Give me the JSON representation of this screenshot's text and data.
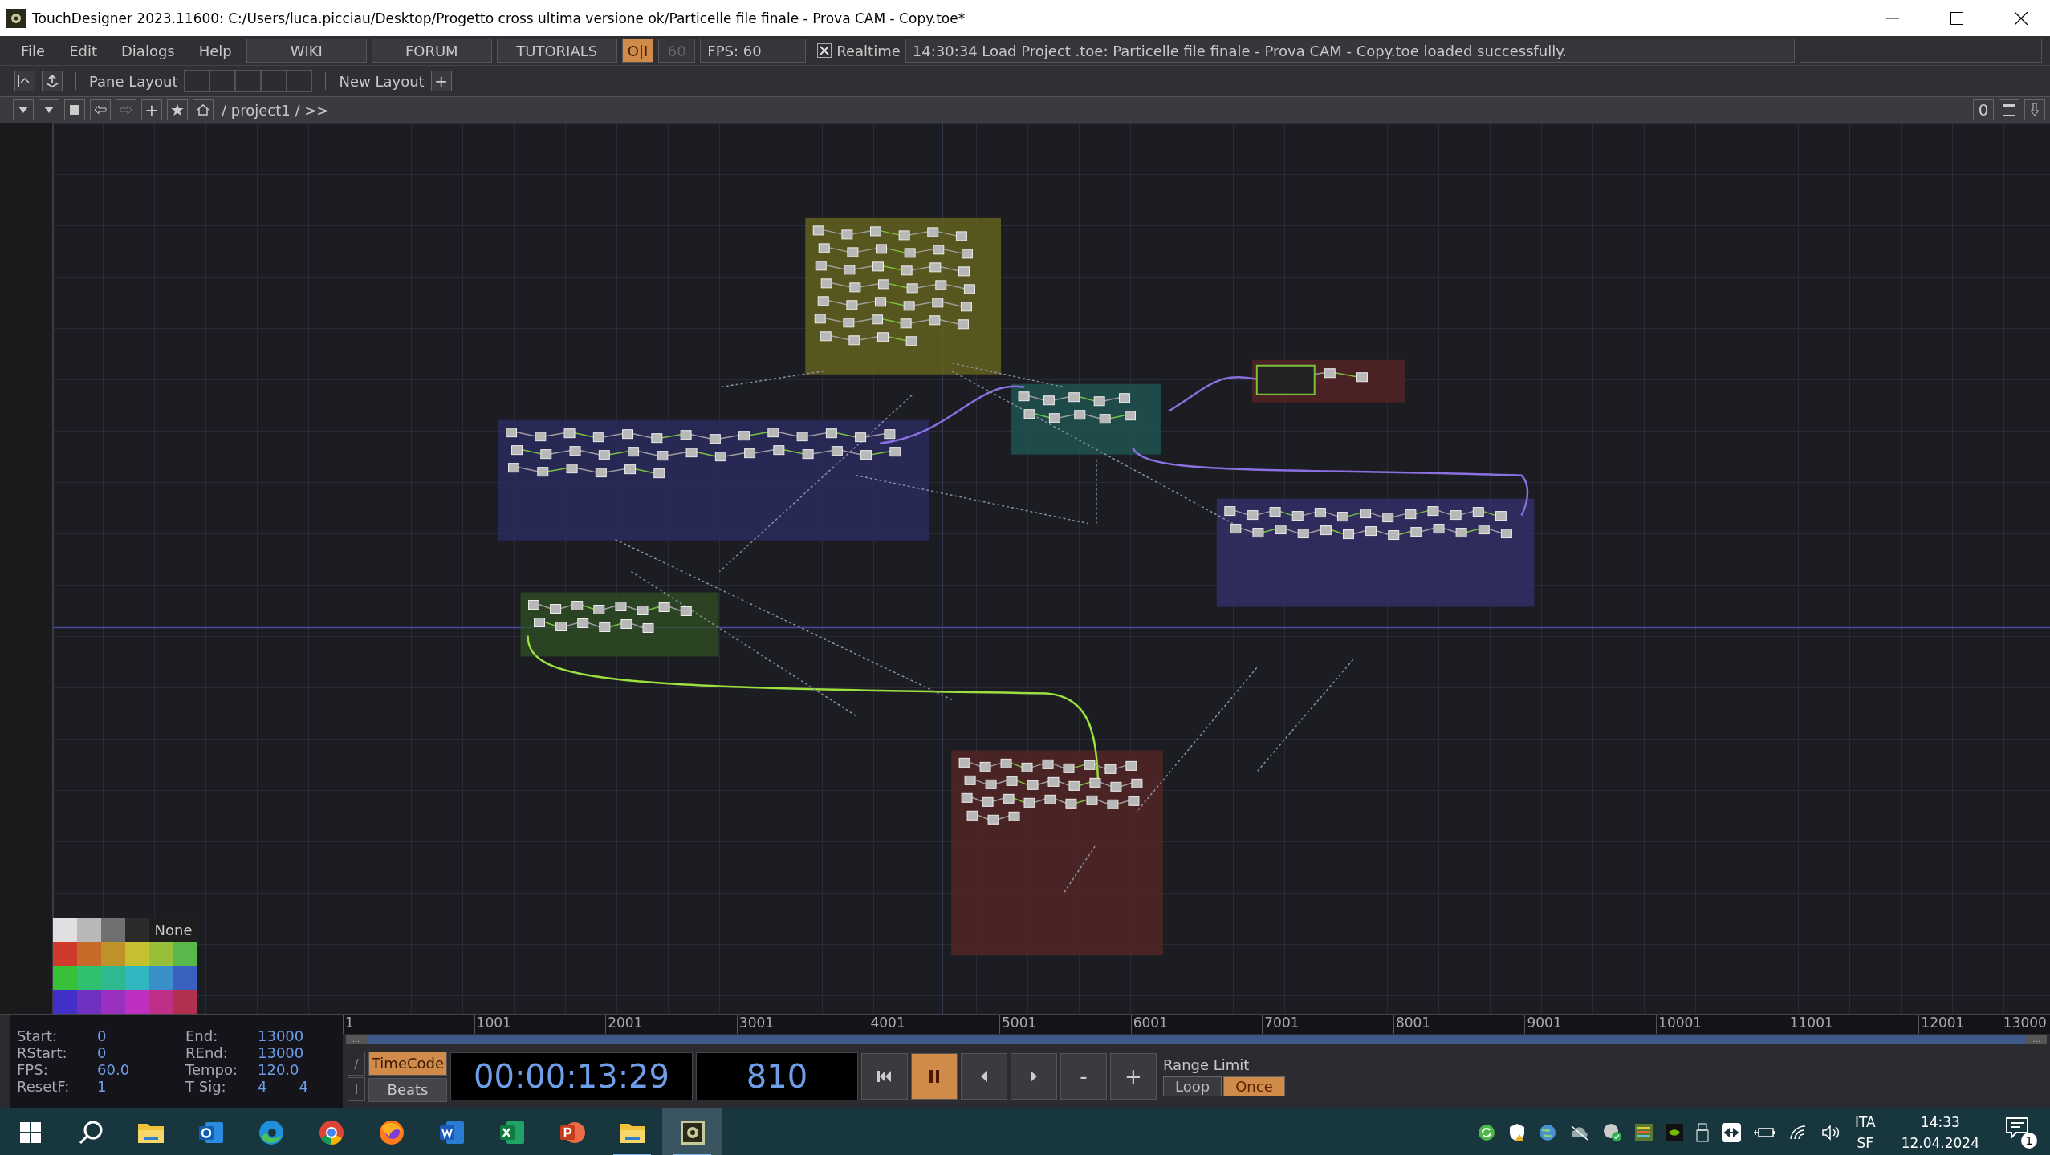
{
  "window": {
    "title": "TouchDesigner 2023.11600: C:/Users/luca.picciau/Desktop/Progetto cross ultima versione ok/Particelle file finale - Prova CAM - Copy.toe*"
  },
  "menu": [
    "File",
    "Edit",
    "Dialogs",
    "Help"
  ],
  "links": [
    "WIKI",
    "FORUM",
    "TUTORIALS"
  ],
  "perform_toggle": {
    "label": "O|I",
    "on": true
  },
  "fps_cap": "60",
  "fps": "FPS:  60",
  "realtime": {
    "label": "Realtime",
    "checked": true
  },
  "status": "14:30:34 Load Project .toe: Particelle file finale - Prova CAM - Copy.toe loaded successfully.",
  "pane_bar": {
    "pane_layout": "Pane Layout",
    "new_layout": "New Layout",
    "add": "+"
  },
  "path_bar": {
    "add": "+",
    "star": "★",
    "path": "/ project1 / >>",
    "counter": "0"
  },
  "palette": {
    "none_label": "None",
    "grays": [
      {
        "color": "#e0e0e0"
      },
      {
        "color": "#b8b8b8"
      },
      {
        "color": "#707070"
      },
      {
        "color": "#2a2a2a"
      }
    ],
    "colors": [
      {
        "color": "#d03a2e"
      },
      {
        "color": "#c86a2a"
      },
      {
        "color": "#c0922a"
      },
      {
        "color": "#c4c030"
      },
      {
        "color": "#96c03a"
      },
      {
        "color": "#5ab84a"
      },
      {
        "color": "#38c038"
      },
      {
        "color": "#30c070"
      },
      {
        "color": "#30b890"
      },
      {
        "color": "#30b8c0"
      },
      {
        "color": "#3a90c8"
      },
      {
        "color": "#3a60c0"
      },
      {
        "color": "#4030c8"
      },
      {
        "color": "#7030c0"
      },
      {
        "color": "#9a30c0"
      },
      {
        "color": "#c030c0"
      },
      {
        "color": "#c03088"
      },
      {
        "color": "#b03050"
      }
    ]
  },
  "info": [
    {
      "label": "Start:",
      "values": [
        "0"
      ]
    },
    {
      "label": "End:",
      "values": [
        "13000"
      ]
    },
    {
      "label": "RStart:",
      "values": [
        "0"
      ]
    },
    {
      "label": "REnd:",
      "values": [
        "13000"
      ]
    },
    {
      "label": "FPS:",
      "values": [
        "60.0"
      ]
    },
    {
      "label": "Tempo:",
      "values": [
        "120.0"
      ]
    },
    {
      "label": "ResetF:",
      "values": [
        "1"
      ]
    },
    {
      "label": "T Sig:",
      "values": [
        "4",
        "4"
      ]
    }
  ],
  "timeline": {
    "ticks": [
      "1",
      "1001",
      "2001",
      "3001",
      "4001",
      "5001",
      "6001",
      "7001",
      "8001",
      "9001",
      "10001",
      "11001",
      "12001",
      "13000"
    ],
    "handle_label": "..."
  },
  "mode_buttons": [
    "/",
    "I"
  ],
  "time_mode": [
    {
      "label": "TimeCode",
      "selected": true
    },
    {
      "label": "Beats",
      "selected": false
    }
  ],
  "timecode": "00:00:13:29",
  "frame": "810",
  "transport": [
    {
      "kind": "rewind",
      "selected": false
    },
    {
      "kind": "pause",
      "selected": true
    },
    {
      "kind": "step_back",
      "selected": false
    },
    {
      "kind": "step_forward",
      "selected": false
    },
    {
      "kind": "text",
      "label": "-",
      "selected": false
    },
    {
      "kind": "text",
      "label": "+",
      "selected": false
    }
  ],
  "range_limit": {
    "label": "Range Limit",
    "options": [
      {
        "label": "Loop",
        "selected": false
      },
      {
        "label": "Once",
        "selected": true
      }
    ]
  },
  "taskbar": {
    "apps": [
      {
        "kind": "start",
        "running": false,
        "selected": false
      },
      {
        "kind": "search",
        "running": false,
        "selected": false
      },
      {
        "kind": "folder",
        "running": false,
        "selected": false
      },
      {
        "kind": "mail",
        "running": false,
        "selected": false
      },
      {
        "kind": "edge",
        "running": false,
        "selected": false
      },
      {
        "kind": "chrome",
        "running": false,
        "selected": false
      },
      {
        "kind": "firefox",
        "running": false,
        "selected": false
      },
      {
        "kind": "word",
        "running": false,
        "selected": false
      },
      {
        "kind": "excel",
        "running": false,
        "selected": false
      },
      {
        "kind": "powerpoint",
        "running": false,
        "selected": false
      },
      {
        "kind": "folder",
        "running": true,
        "selected": false
      },
      {
        "kind": "touchdesigner",
        "running": true,
        "selected": true
      }
    ],
    "lang": "ITA",
    "layout": "SF",
    "time": "14:33",
    "date": "12.04.2024",
    "notifications": "1"
  }
}
